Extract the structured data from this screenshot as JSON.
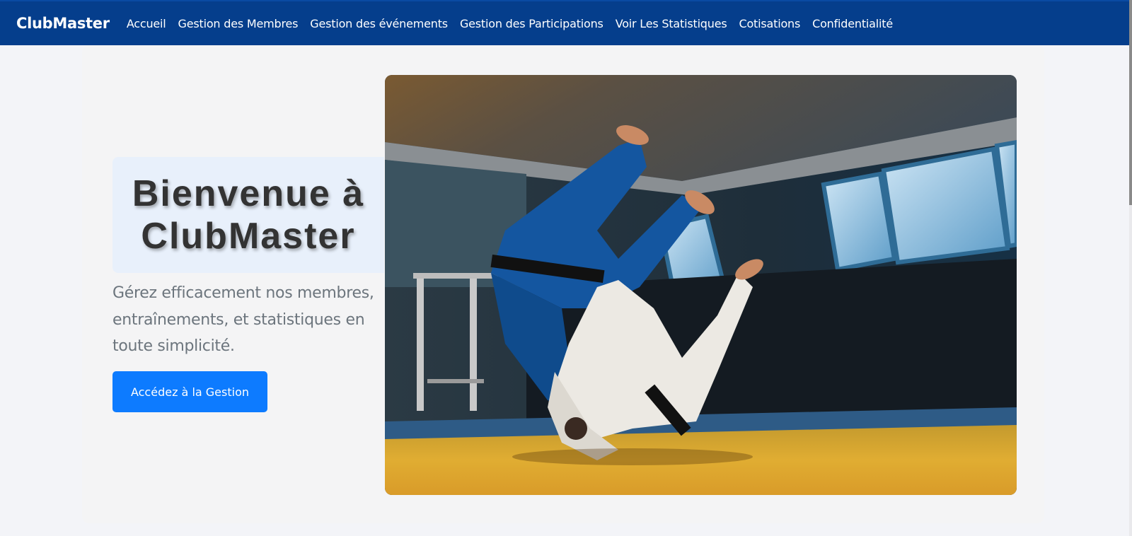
{
  "navbar": {
    "brand": "ClubMaster",
    "links": [
      "Accueil",
      "Gestion des Membres",
      "Gestion des événements",
      "Gestion des Participations",
      "Voir Les Statistiques",
      "Cotisations",
      "Confidentialité"
    ],
    "background_color": "#053e8c"
  },
  "hero": {
    "title_line1": "Bienvenue à",
    "title_line2": "ClubMaster",
    "subtitle": "Gérez efficacement nos membres, entraînements, et statistiques en toute simplicité.",
    "cta_label": "Accédez à la Gestion",
    "cta_color": "#0d7bff",
    "image_subject": "judo-throw-photo"
  }
}
